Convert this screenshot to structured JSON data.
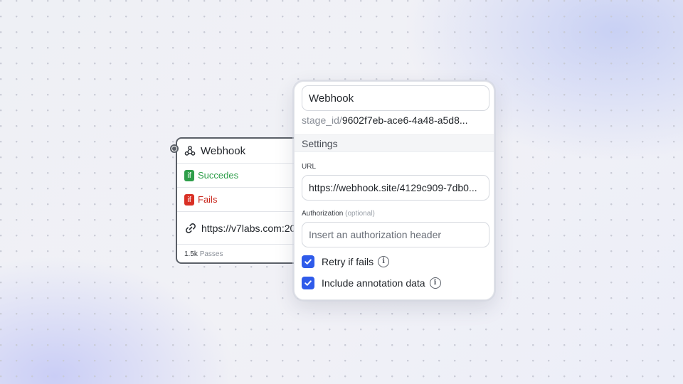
{
  "node": {
    "title": "Webhook",
    "success_badge": "if",
    "success_label": "Succedes",
    "fail_badge": "if",
    "fail_label": "Fails",
    "url": "https://v7labs.com:20",
    "passes_count": "1.5k",
    "passes_label": "Passes",
    "icons": {
      "header": "webhook-icon",
      "url": "link-icon"
    }
  },
  "popover": {
    "name_value": "Webhook",
    "stage_prefix": "stage_id/",
    "stage_value": "9602f7eb-ace6-4a48-a5d8...",
    "settings_heading": "Settings",
    "url_label": "URL",
    "url_value": "https://webhook.site/4129c909-7db0...",
    "auth_label": "Authorization",
    "auth_optional": "(optional)",
    "auth_placeholder": "Insert an authorization header",
    "retry_label": "Retry if fails",
    "retry_checked": true,
    "include_label": "Include annotation data",
    "include_checked": true
  },
  "colors": {
    "checkbox": "#2f5bea",
    "success": "#2e9e4a",
    "fail": "#d93025",
    "node_border": "#5b6068"
  }
}
